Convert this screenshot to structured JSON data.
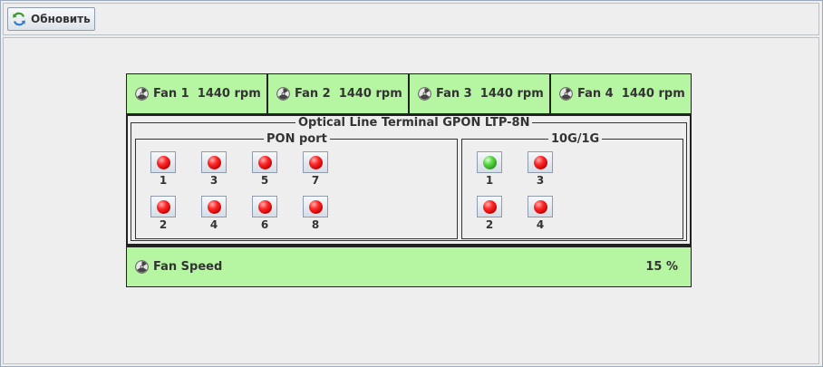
{
  "toolbar": {
    "refresh_label": "Обновить",
    "refresh_icon": "refresh-icon"
  },
  "fans": [
    {
      "label": "Fan 1  1440 rpm",
      "icon": "fan-icon"
    },
    {
      "label": "Fan 2  1440 rpm",
      "icon": "fan-icon"
    },
    {
      "label": "Fan 3  1440 rpm",
      "icon": "fan-icon"
    },
    {
      "label": "Fan 4  1440 rpm",
      "icon": "fan-icon"
    }
  ],
  "olt": {
    "title": "Optical Line Terminal GPON LTP-8N",
    "pon": {
      "title": "PON port",
      "ports": [
        {
          "label": "1",
          "status": "red"
        },
        {
          "label": "3",
          "status": "red"
        },
        {
          "label": "5",
          "status": "red"
        },
        {
          "label": "7",
          "status": "red"
        },
        {
          "label": "2",
          "status": "red"
        },
        {
          "label": "4",
          "status": "red"
        },
        {
          "label": "6",
          "status": "red"
        },
        {
          "label": "8",
          "status": "red"
        }
      ]
    },
    "uplink": {
      "title": "10G/1G",
      "ports": [
        {
          "label": "1",
          "status": "green"
        },
        {
          "label": "3",
          "status": "red"
        },
        {
          "label": "2",
          "status": "red"
        },
        {
          "label": "4",
          "status": "red"
        }
      ]
    }
  },
  "fan_speed": {
    "label": "Fan Speed",
    "value": "15 %"
  },
  "colors": {
    "panel_green": "#b6f6a3",
    "led_red": "#e00000",
    "led_green": "#3cbf2e"
  }
}
